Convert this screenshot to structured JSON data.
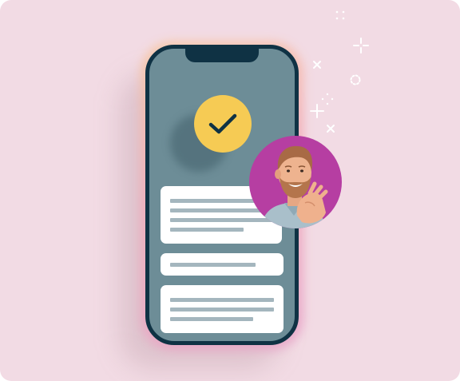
{
  "illustration": {
    "background_color": "#f2dbe4",
    "phone_frame_color": "#0f3244",
    "phone_screen_color": "#6d8d97",
    "card_color": "#ffffff",
    "placeholder_line_color": "#a4b6be",
    "icons": {
      "check_badge": "check-icon",
      "check_badge_color": "#f6cb54",
      "avatar": "person-photo",
      "avatar_background_color": "#b63ea2",
      "sparkles": "sparkle-icon"
    }
  }
}
